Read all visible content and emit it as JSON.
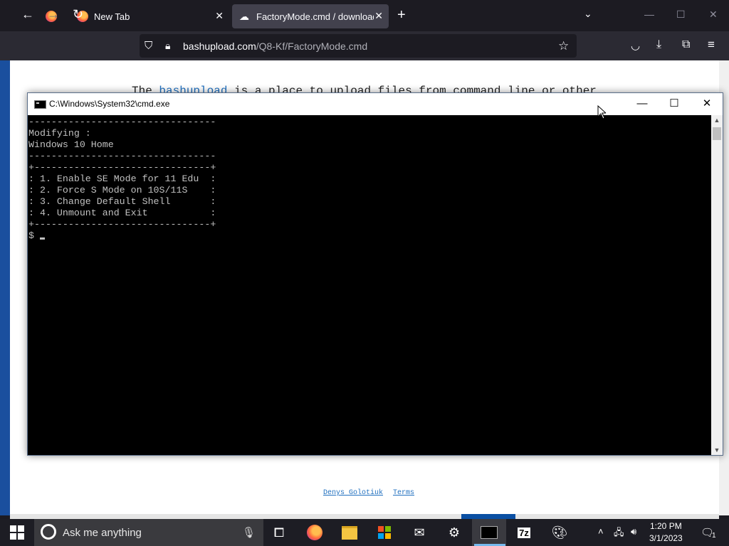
{
  "browser": {
    "tabs": [
      {
        "label": "",
        "icon": "firefox-icon"
      },
      {
        "label": "New Tab",
        "icon": "firefox-icon"
      },
      {
        "label": "FactoryMode.cmd / download",
        "icon": "cloud-icon",
        "active": true
      }
    ],
    "url_host": "bashupload.com",
    "url_path": "/Q8-Kf/FactoryMode.cmd"
  },
  "page": {
    "intro_prefix": "The ",
    "intro_link": "bashupload",
    "intro_suffix": " is a place to upload files from command line or other",
    "footer_links": [
      "Denys Golotiuk",
      "Terms"
    ]
  },
  "cmd": {
    "title": "C:\\Windows\\System32\\cmd.exe",
    "lines": [
      "---------------------------------",
      "Modifying :",
      "Windows 10 Home",
      "---------------------------------",
      "+-------------------------------+",
      ": 1. Enable SE Mode for 11 Edu  :",
      ": 2. Force S Mode on 10S/11S    :",
      ": 3. Change Default Shell       :",
      ": 4. Unmount and Exit           :",
      "+-------------------------------+"
    ],
    "prompt": "$ "
  },
  "taskbar": {
    "search_placeholder": "Ask me anything",
    "time": "1:20 PM",
    "date": "3/1/2023",
    "notification_count": "1"
  }
}
